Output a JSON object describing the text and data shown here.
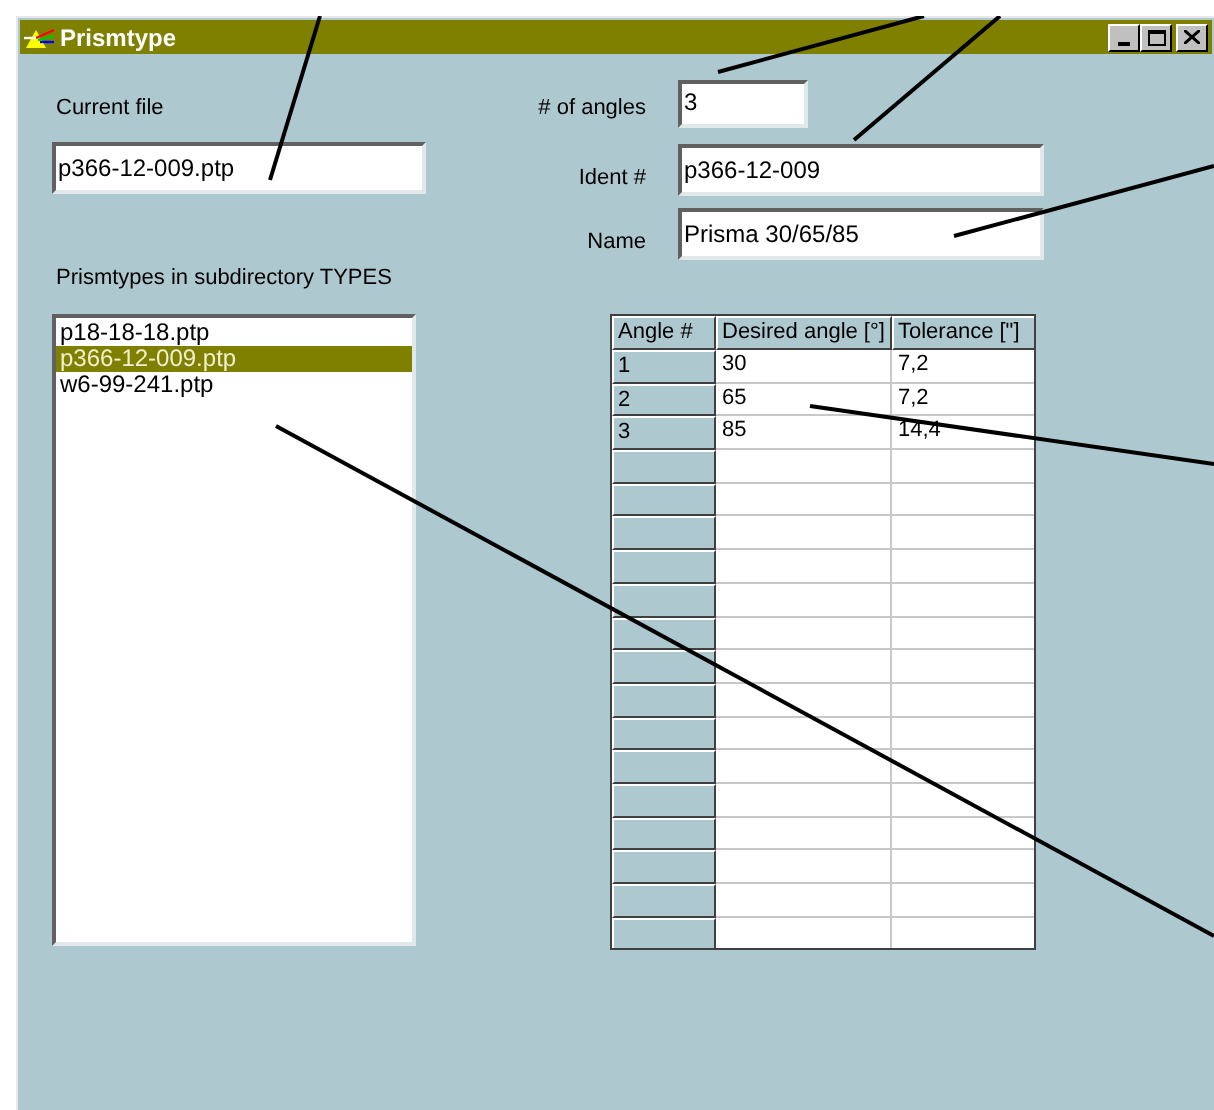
{
  "window": {
    "title": "Prismtype"
  },
  "current_file": {
    "label": "Current file",
    "value": "p366-12-009.ptp"
  },
  "fields": [
    {
      "label": "# of angles",
      "value": "3"
    },
    {
      "label": "Ident #",
      "value": "p366-12-009"
    },
    {
      "label": "Name",
      "value": "Prisma 30/65/85"
    }
  ],
  "prismtypes": {
    "label": "Prismtypes in subdirectory TYPES",
    "items": [
      {
        "label": "p18-18-18.ptp",
        "selected": false
      },
      {
        "label": "p366-12-009.ptp",
        "selected": true
      },
      {
        "label": "w6-99-241.ptp",
        "selected": false
      }
    ]
  },
  "table": {
    "columns": [
      "Angle #",
      "Desired angle [°]",
      "Tolerance [\"]"
    ],
    "rows": [
      [
        "1",
        "30",
        "7,2"
      ],
      [
        "2",
        "65",
        "7,2"
      ],
      [
        "3",
        "85",
        "14,4"
      ]
    ]
  }
}
